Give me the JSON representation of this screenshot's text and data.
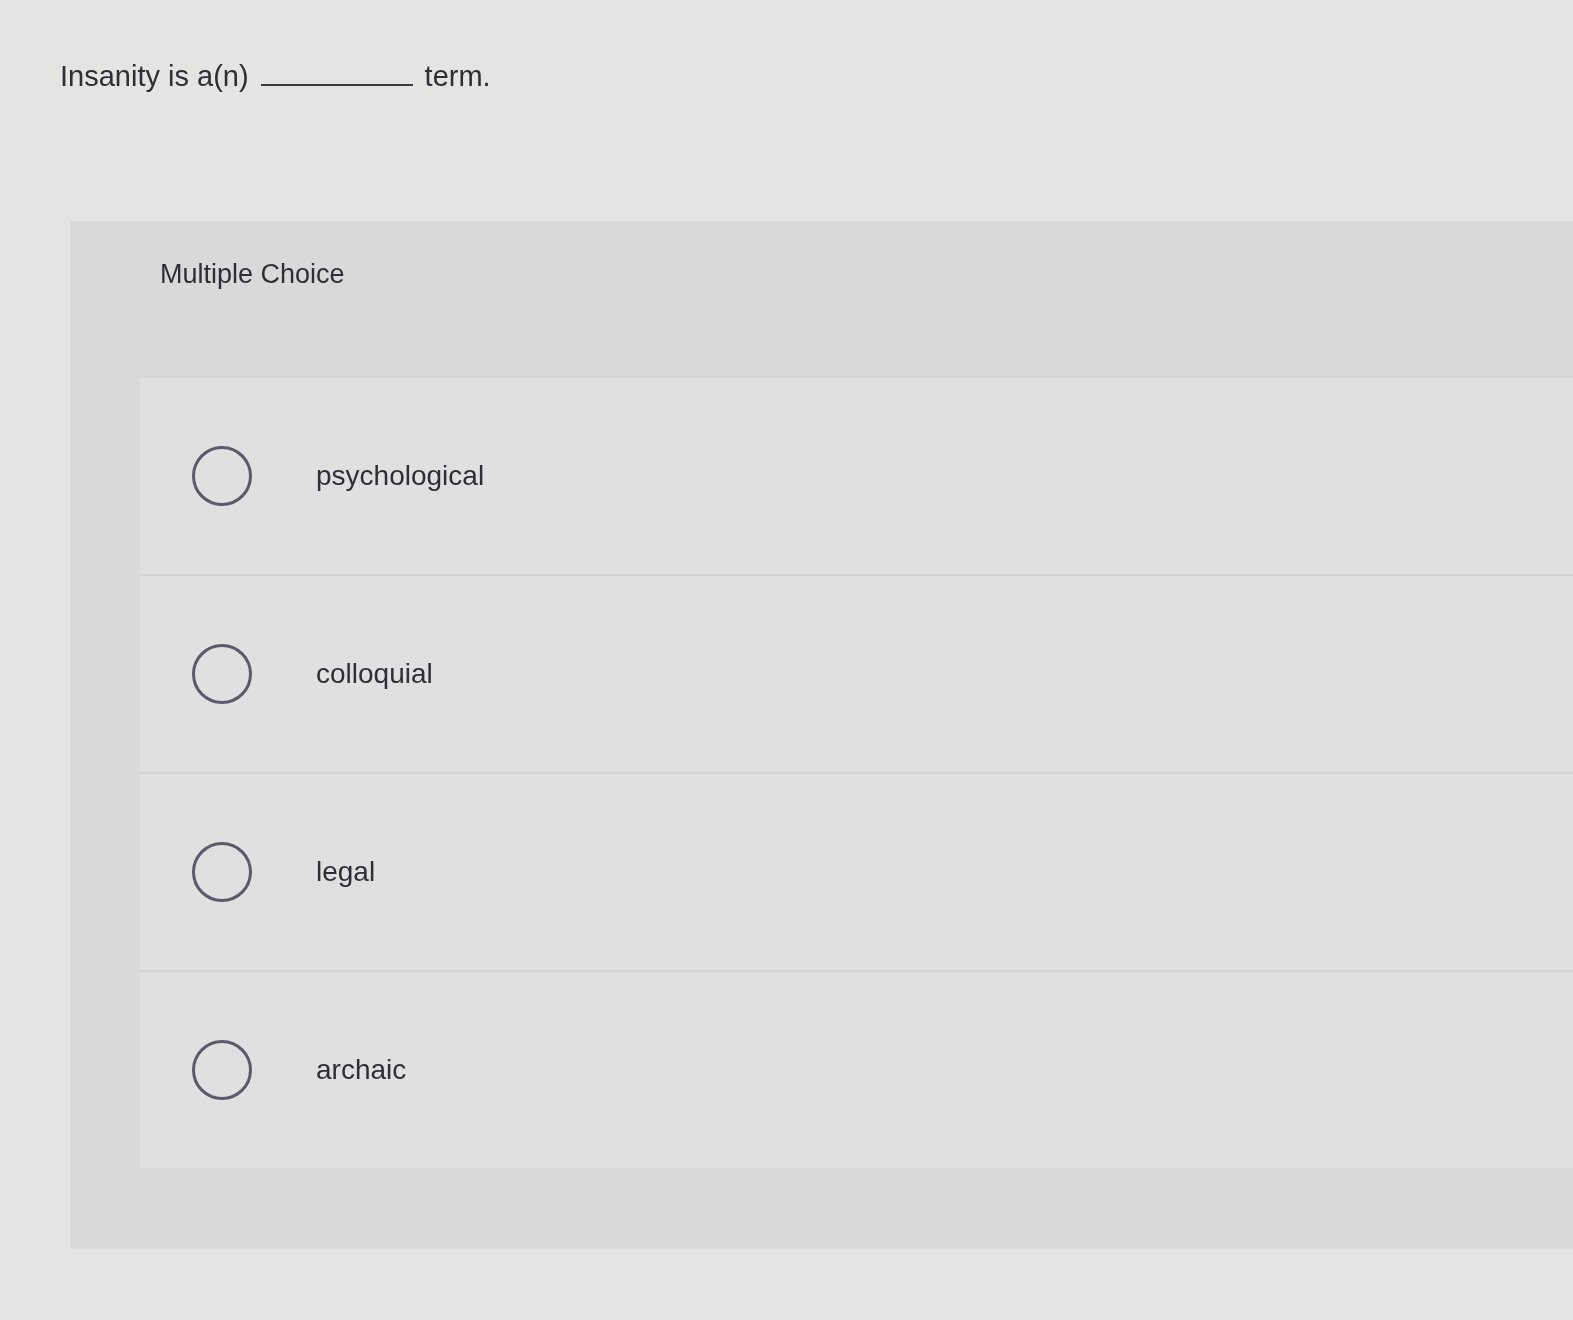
{
  "question": {
    "text_before": "Insanity is a(n)",
    "text_after": "term."
  },
  "section": {
    "title": "Multiple Choice"
  },
  "options": [
    {
      "label": "psychological",
      "selected": false
    },
    {
      "label": "colloquial",
      "selected": false
    },
    {
      "label": "legal",
      "selected": false
    },
    {
      "label": "archaic",
      "selected": false
    }
  ]
}
